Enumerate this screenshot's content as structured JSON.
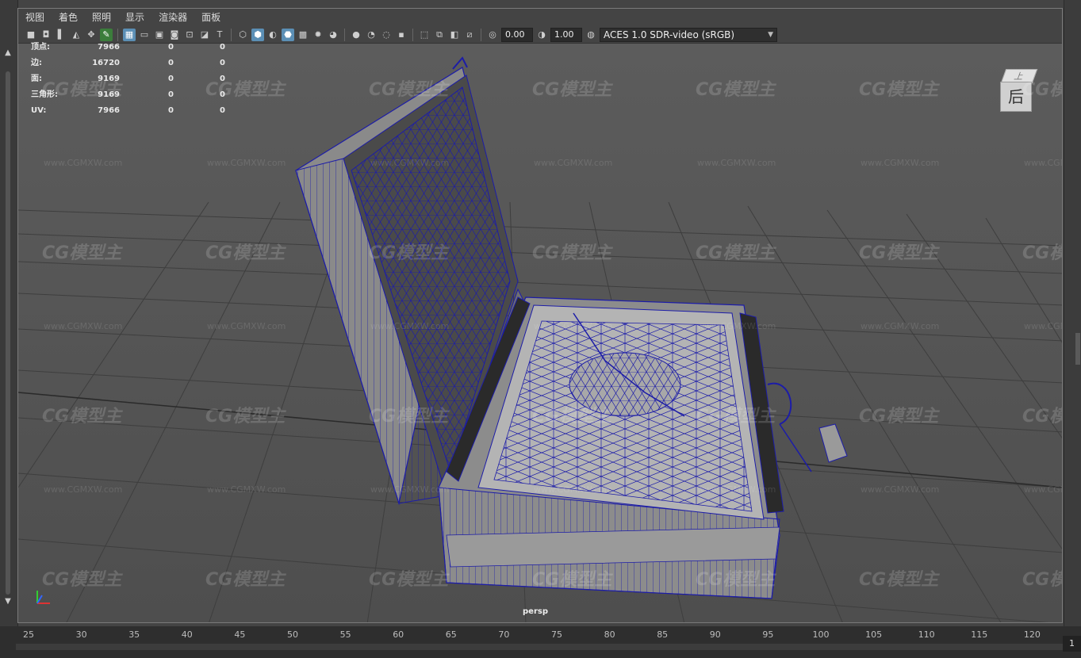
{
  "menu": [
    "视图",
    "着色",
    "照明",
    "显示",
    "渲染器",
    "面板"
  ],
  "toolbar": {
    "exposure": "0.00",
    "gamma": "1.00",
    "color_space": "ACES 1.0 SDR-video (sRGB)"
  },
  "hud": {
    "rows": [
      {
        "label": "顶点:",
        "v1": "7966",
        "v2": "0",
        "v3": "0"
      },
      {
        "label": "边:",
        "v1": "16720",
        "v2": "0",
        "v3": "0"
      },
      {
        "label": "面:",
        "v1": "9169",
        "v2": "0",
        "v3": "0"
      },
      {
        "label": "三角形:",
        "v1": "9169",
        "v2": "0",
        "v3": "0"
      },
      {
        "label": "UV:",
        "v1": "7966",
        "v2": "0",
        "v3": "0"
      }
    ]
  },
  "viewcube": {
    "face": "后",
    "top": "上"
  },
  "camera": "persp",
  "watermark": {
    "logo": "CG模型主",
    "url": "www.CGMXW.com"
  },
  "timeline": {
    "ticks": [
      "25",
      "30",
      "35",
      "40",
      "45",
      "50",
      "55",
      "60",
      "65",
      "70",
      "75",
      "80",
      "85",
      "90",
      "95",
      "100",
      "105",
      "110",
      "115",
      "120"
    ],
    "current_frame": "1"
  },
  "colors": {
    "wire": "#1a1aa0",
    "grid": "#3a3a3a",
    "viewport_bg": "#565656"
  }
}
